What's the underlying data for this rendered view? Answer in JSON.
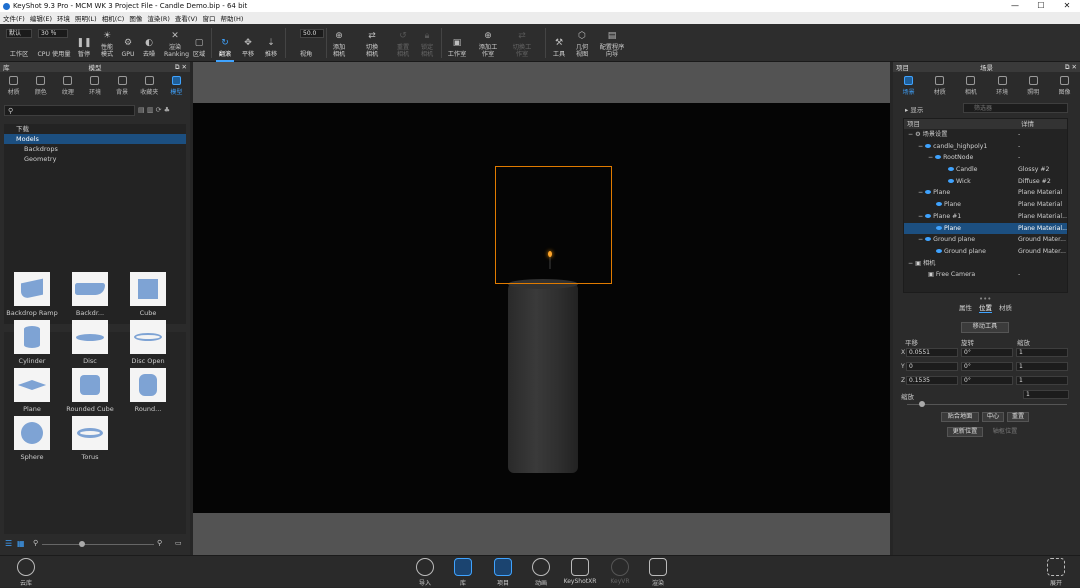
{
  "window": {
    "title": "KeyShot 9.3 Pro  -  MCM WK 3 Project File  - Candle Demo.bip  - 64 bit",
    "min": "—",
    "max": "☐",
    "close": "✕"
  },
  "menu": [
    "文件(F)",
    "编辑(E)",
    "环境",
    "照明(L)",
    "相机(C)",
    "图像",
    "渲染(R)",
    "查看(V)",
    "窗口",
    "帮助(H)"
  ],
  "toolbar": {
    "workspace_value": "默认",
    "fps_value": "30 ％",
    "angle_value": "50.0",
    "items": [
      "工作区",
      "CPU 使用量",
      "暂停",
      "性能模式",
      "GPU",
      "去噪",
      "渲染 Ranking",
      "区域",
      "翻滚",
      "平移",
      "推移",
      "视角",
      "添加相机",
      "切换相机",
      "重置相机",
      "锁定相机",
      "工作室",
      "添加工作室",
      "切换工作室",
      "工具",
      "几何视图",
      "配置程序向导"
    ]
  },
  "library": {
    "title": "库",
    "subtitle": "模型",
    "tabs": [
      "材质",
      "颜色",
      "纹理",
      "环境",
      "背景",
      "收藏夹",
      "模型"
    ],
    "tree": [
      "下载",
      "Models",
      "Backdrops",
      "Geometry"
    ],
    "thumbs": [
      "Backdrop Ramp",
      "Backdr...",
      "Cube",
      "Cylinder",
      "Disc",
      "Disc Open",
      "Plane",
      "Rounded Cube",
      "Round...",
      "Sphere",
      "Torus"
    ]
  },
  "project": {
    "title": "项目",
    "subtitle": "场景",
    "tabs": [
      "场景",
      "材质",
      "相机",
      "环境",
      "照明",
      "图像"
    ],
    "show_label": "显示",
    "search_placeholder": "筛选器",
    "columns": [
      "项目",
      "详情"
    ],
    "rows": [
      {
        "name": "场景设置",
        "mat": "-"
      },
      {
        "name": "candle_highpoly1",
        "mat": "-"
      },
      {
        "name": "RootNode",
        "mat": "-"
      },
      {
        "name": "Candle",
        "mat": "Glossy #2"
      },
      {
        "name": "Wick",
        "mat": "Diffuse #2"
      },
      {
        "name": "Plane",
        "mat": "Plane Material"
      },
      {
        "name": "Plane",
        "mat": "Plane Material"
      },
      {
        "name": "Plane #1",
        "mat": "Plane Material..."
      },
      {
        "name": "Plane",
        "mat": "Plane Material..."
      },
      {
        "name": "Ground plane",
        "mat": "Ground Mater..."
      },
      {
        "name": "Ground plane",
        "mat": "Ground Mater..."
      },
      {
        "name": "相机",
        "mat": ""
      },
      {
        "name": "Free Camera",
        "mat": "-"
      }
    ],
    "subtabs": [
      "属性",
      "位置",
      "材质"
    ],
    "move_tool": "移动工具",
    "transform_headers": [
      "平移",
      "旋转",
      "缩放"
    ],
    "axes": [
      "X",
      "Y",
      "Z"
    ],
    "translate": [
      "0.0551",
      "0",
      "0.1535"
    ],
    "rotate": [
      "0°",
      "0°",
      "0°"
    ],
    "scale": [
      "1",
      "1",
      "1"
    ],
    "uniform_label": "缩放",
    "uniform_value": "1",
    "buttons": [
      "贴合地面",
      "中心",
      "重置",
      "更新位置",
      "轴枢位置"
    ]
  },
  "bottom": {
    "left": "云库",
    "right": "展开",
    "items": [
      "导入",
      "库",
      "项目",
      "动画",
      "KeyShotXR",
      "KeyVR",
      "渲染"
    ]
  }
}
